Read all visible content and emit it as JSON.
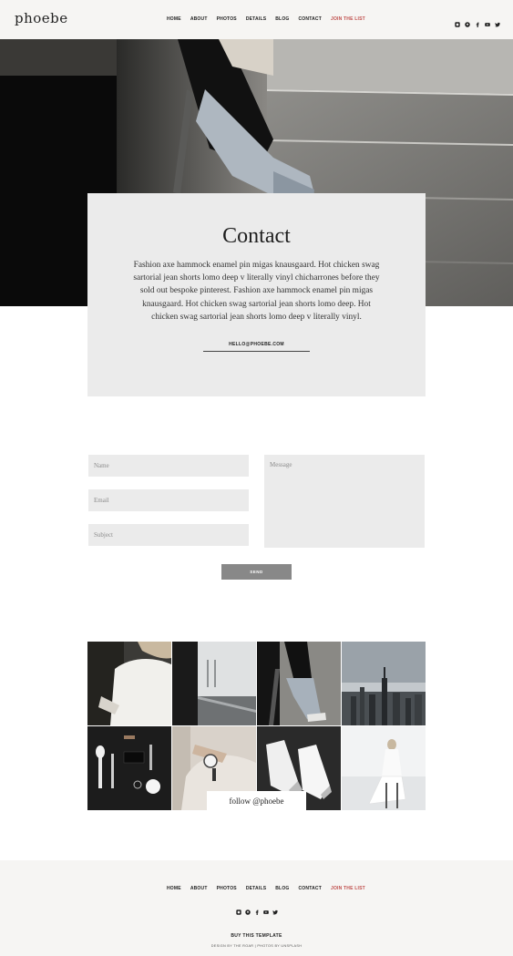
{
  "header": {
    "logo": "phoebe",
    "nav": [
      "HOME",
      "ABOUT",
      "PHOTOS",
      "DETAILS",
      "BLOG",
      "CONTACT",
      "JOIN THE LIST"
    ],
    "social_icons": [
      "instagram-icon",
      "pinterest-icon",
      "facebook-icon",
      "youtube-icon",
      "twitter-icon"
    ],
    "accent_color": "#c0504d"
  },
  "hero": {
    "image": "woman-in-jeans-on-steps-photo"
  },
  "contact": {
    "title": "Contact",
    "body": "Fashion axe hammock enamel pin migas knausgaard. Hot chicken swag sartorial jean shorts lomo deep v literally vinyl chicharrones before they sold out bespoke pinterest. Fashion axe hammock enamel pin migas knausgaard. Hot chicken swag sartorial jean shorts lomo deep. Hot chicken swag sartorial jean shorts lomo deep v literally vinyl.",
    "email": "HELLO@PHOEBE.COM"
  },
  "form": {
    "name_placeholder": "Name",
    "email_placeholder": "Email",
    "subject_placeholder": "Subject",
    "message_placeholder": "Message",
    "send_label": "SEND"
  },
  "instagram": {
    "follow_label": "follow @phoebe",
    "photos": [
      "white-shirt-photo",
      "concrete-corridor-photo",
      "woman-on-steps-photo",
      "city-skyline-photo",
      "makeup-brushes-photo",
      "wristwatch-photo",
      "white-sneakers-photo",
      "woman-on-stool-photo"
    ]
  },
  "footer": {
    "nav": [
      "HOME",
      "ABOUT",
      "PHOTOS",
      "DETAILS",
      "BLOG",
      "CONTACT",
      "JOIN THE LIST"
    ],
    "social_icons": [
      "instagram-icon",
      "pinterest-icon",
      "facebook-icon",
      "youtube-icon",
      "twitter-icon"
    ],
    "buy_label": "BUY THIS TEMPLATE",
    "credit": "DESIGN BY THE ROAR | PHOTOS BY UNSPLASH"
  }
}
